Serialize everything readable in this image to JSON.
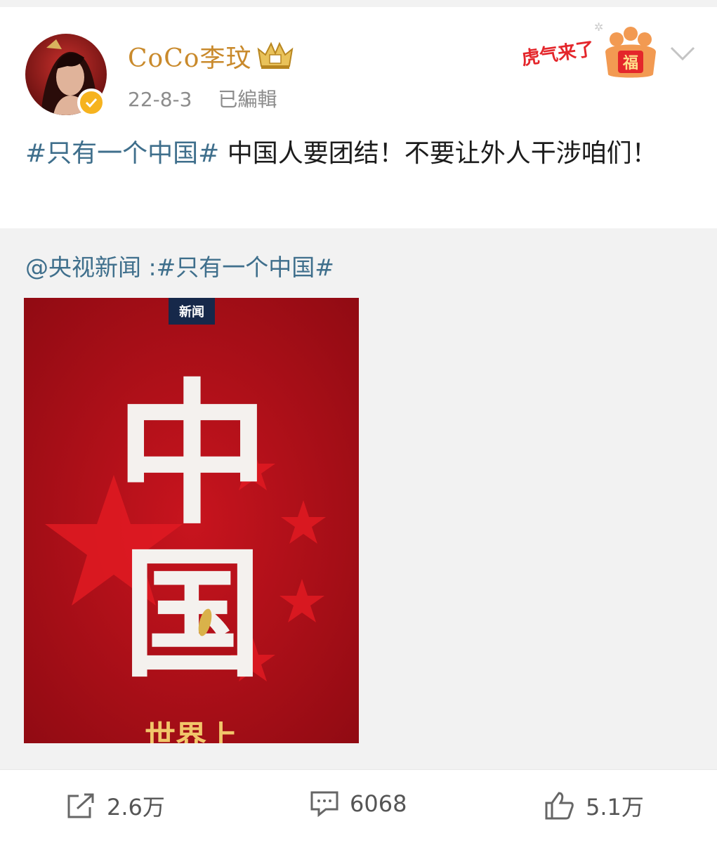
{
  "post": {
    "username": "CoCo李玟",
    "date": "22-8-3",
    "edited": "已編輯",
    "hashtag": "#只有一个中国#",
    "body": " 中国人要团结！不要让外人干涉咱们！"
  },
  "badge": {
    "tiger_text": "虎气来了",
    "fu": "福"
  },
  "repost": {
    "source": "@央视新闻",
    "separator": " :",
    "hashtag": "#只有一个中国#",
    "image": {
      "logo_text": "新闻",
      "main_chars": [
        "中",
        "国"
      ],
      "bottom_text": "世界上"
    }
  },
  "actions": {
    "share_count": "2.6万",
    "comment_count": "6068",
    "like_count": "5.1万"
  },
  "colors": {
    "username": "#c98a2c",
    "hashtag": "#3f6f8c",
    "poster_red": "#b3101a",
    "verified": "#f6b31f"
  }
}
